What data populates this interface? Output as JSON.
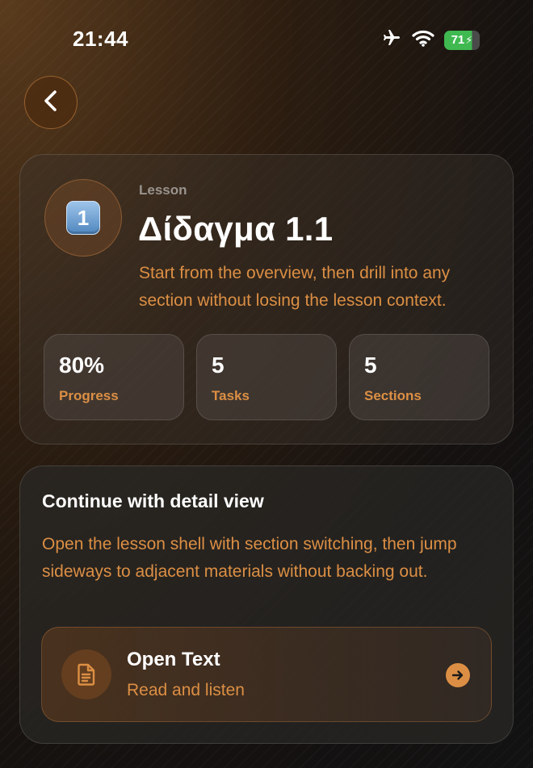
{
  "status_bar": {
    "time": "21:44",
    "battery_level": "71",
    "icons": [
      "airplane-icon",
      "wifi-icon",
      "battery-charging-icon"
    ]
  },
  "nav": {
    "back_icon": "chevron-left-icon"
  },
  "hero": {
    "badge_number": "1",
    "eyebrow": "Lesson",
    "title": "Δίδαγμα 1.1",
    "subtitle": "Start from the overview, then drill into any section without losing the lesson context.",
    "stats": [
      {
        "value": "80%",
        "label": "Progress"
      },
      {
        "value": "5",
        "label": "Tasks"
      },
      {
        "value": "5",
        "label": "Sections"
      }
    ]
  },
  "detail": {
    "title": "Continue with detail view",
    "body": "Open the lesson shell with section switching, then jump sideways to adjacent materials without backing out.",
    "action": {
      "icon": "document-icon",
      "title": "Open Text",
      "subtitle": "Read and listen",
      "trailing_icon": "arrow-right-circle-icon"
    }
  },
  "colors": {
    "accent": "#dc8f44",
    "battery_green": "#3fb950",
    "key_blue": "#6b9fd4"
  }
}
